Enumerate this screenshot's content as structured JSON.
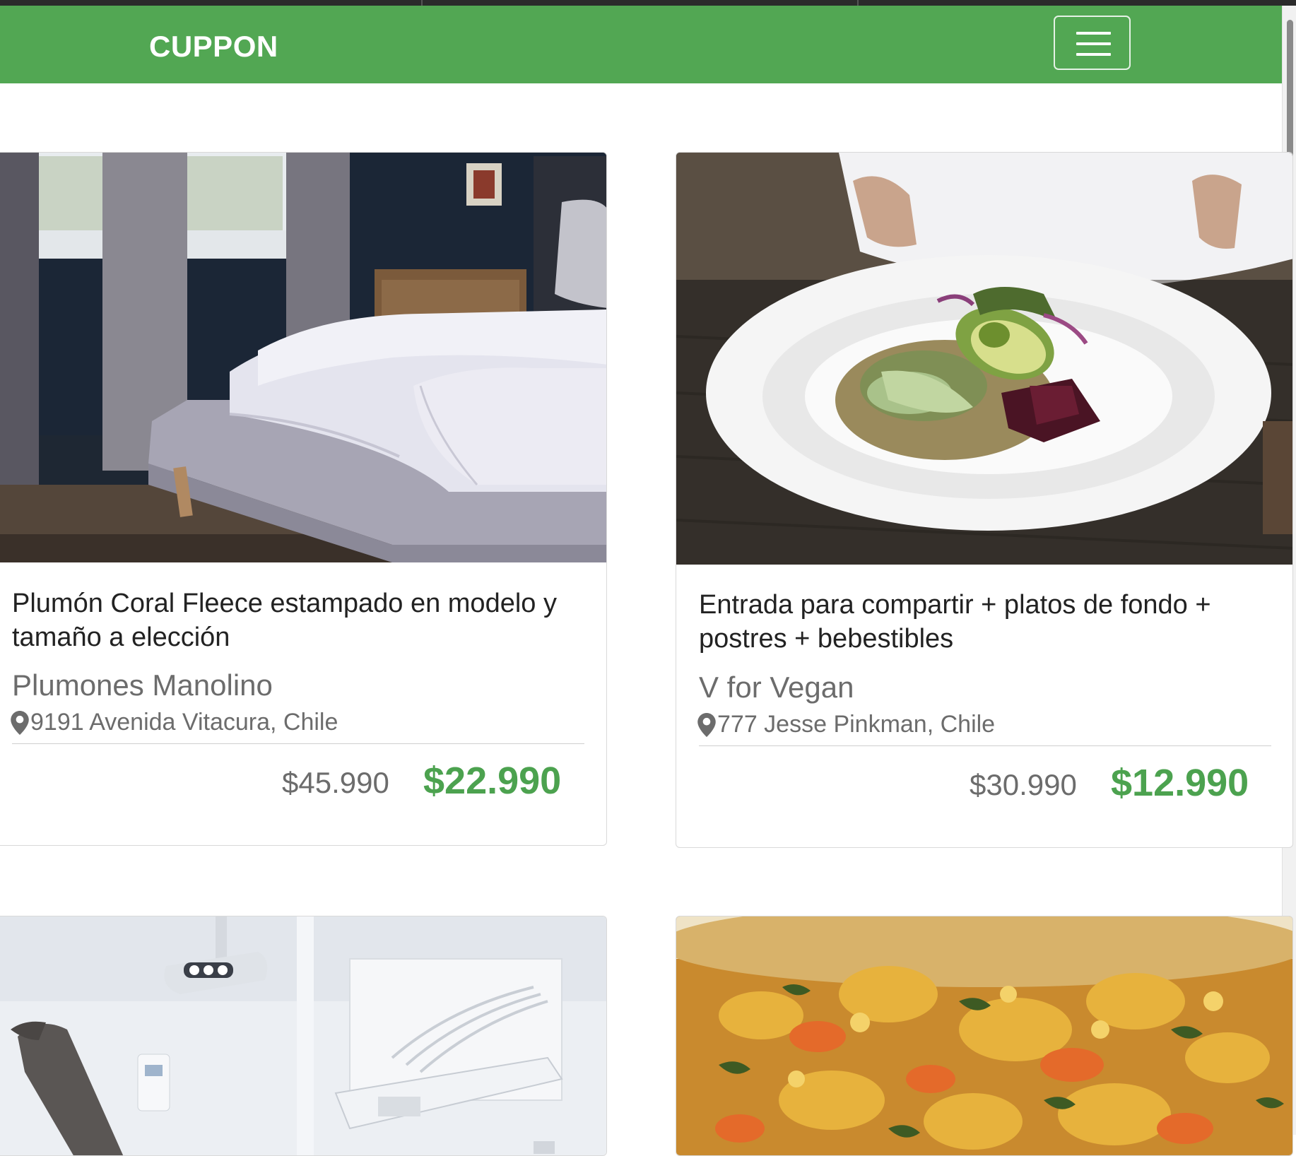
{
  "navbar": {
    "brand": "CUPPON",
    "menu_icon": "hamburger-menu-icon",
    "background": "#52a753"
  },
  "cards": [
    {
      "image": "bedroom-bed-photo",
      "title": "Plumón Coral Fleece estampado en modelo y tamaño a elección",
      "vendor": "Plumones Manolino",
      "location": "9191 Avenida Vitacura, Chile",
      "location_icon": "map-marker-icon",
      "old_price": "$45.990",
      "new_price": "$22.990"
    },
    {
      "image": "vegan-plate-photo",
      "title": "Entrada para compartir + platos de fondo + postres + bebestibles",
      "vendor": "V for Vegan",
      "location": "777 Jesse Pinkman, Chile",
      "location_icon": "map-marker-icon",
      "old_price": "$30.990",
      "new_price": "$12.990"
    },
    {
      "image": "dental-chair-photo"
    },
    {
      "image": "food-dish-photo"
    }
  ],
  "colors": {
    "accent": "#52a753",
    "price_green": "#4ca24f",
    "muted_text": "#6c6c6c"
  }
}
